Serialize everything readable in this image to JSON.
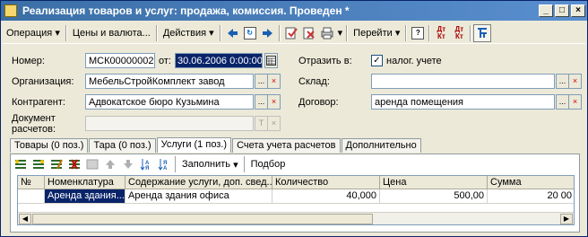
{
  "window": {
    "title": "Реализация товаров и услуг: продажа, комиссия. Проведен *",
    "controls": {
      "minimize": "_",
      "maximize": "□",
      "close": "×"
    }
  },
  "toolbar": {
    "operation": "Операция",
    "prices_currency": "Цены и валюта...",
    "actions": "Действия",
    "goto": "Перейти",
    "help": "?",
    "dt_kt_1": "Дт Кт",
    "dt_kt_2": "Дт Кт",
    "dropdown_arrow": "▾"
  },
  "form": {
    "number_label": "Номер:",
    "number_value": "МСК00000002",
    "from_label": "от:",
    "date_value": "30.06.2006  0:00:00",
    "org_label": "Организация:",
    "org_value": "МебельСтройКомплект завод",
    "contractor_label": "Контрагент:",
    "contractor_value": "Адвокатское бюро Кузьмина",
    "settlement_label_1": "Документ",
    "settlement_label_2": "расчетов:",
    "reflect_label": "Отразить в:",
    "tax_label": "налог. учете",
    "tax_checked": "✓",
    "warehouse_label": "Склад:",
    "warehouse_value": "",
    "contract_label": "Договор:",
    "contract_value": "аренда помещения",
    "ellipsis": "...",
    "clear": "×",
    "t_btn": "T"
  },
  "tabs": [
    {
      "label": "Товары (0 поз.)"
    },
    {
      "label": "Тара (0 поз.)"
    },
    {
      "label": "Услуги (1 поз.)"
    },
    {
      "label": "Счета учета расчетов"
    },
    {
      "label": "Дополнительно"
    }
  ],
  "subtoolbar": {
    "fill": "Заполнить",
    "selection": "Подбор"
  },
  "table": {
    "columns": [
      "№",
      "Номенклатура",
      "Содержание услуги, доп. свед...",
      "Количество",
      "Цена",
      "Сумма"
    ],
    "rows": [
      {
        "num": "",
        "item": "Аренда здания...",
        "content": "Аренда здания офиса",
        "qty": "40,000",
        "price": "500,00",
        "sum": "20 00"
      }
    ]
  }
}
